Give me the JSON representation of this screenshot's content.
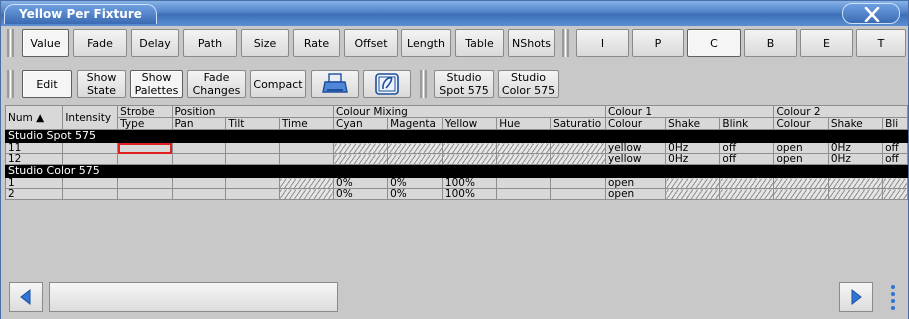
{
  "window": {
    "title": "Yellow Per Fixture"
  },
  "toolbar1": {
    "buttons": [
      "Value",
      "Fade",
      "Delay",
      "Path",
      "Size",
      "Rate",
      "Offset",
      "Length",
      "Table",
      "NShots"
    ],
    "feature_buttons": [
      "I",
      "P",
      "C",
      "B",
      "E",
      "T"
    ],
    "selected": "Value",
    "selected_feature": "C"
  },
  "toolbar2": {
    "edit": "Edit",
    "show_state": [
      "Show",
      "State"
    ],
    "show_palettes": [
      "Show",
      "Palettes"
    ],
    "fade_changes": [
      "Fade",
      "Changes"
    ],
    "compact": "Compact",
    "fixture_spot": [
      "Studio",
      "Spot 575"
    ],
    "fixture_color": [
      "Studio",
      "Color 575"
    ]
  },
  "grid": {
    "group_headers": {
      "strobe": "Strobe",
      "position": "Position",
      "colour_mixing": "Colour Mixing",
      "colour1": "Colour 1",
      "colour2": "Colour 2"
    },
    "columns": [
      "Num",
      "Intensity",
      "Type",
      "Pan",
      "Tilt",
      "Time",
      "Cyan",
      "Magenta",
      "Yellow",
      "Hue",
      "Saturatio",
      "Colour",
      "Shake",
      "Blink",
      "Colour",
      "Shake",
      "Bli"
    ],
    "sort_indicator": "▲",
    "groups": [
      {
        "name": "Studio Spot 575",
        "rows": [
          {
            "num": "11",
            "colour1": "yellow",
            "shake1": "0Hz",
            "blink1": "off",
            "colour2": "open",
            "shake2": "0Hz",
            "blink2": "off"
          },
          {
            "num": "12",
            "colour1": "yellow",
            "shake1": "0Hz",
            "blink1": "off",
            "colour2": "open",
            "shake2": "0Hz",
            "blink2": "off"
          }
        ]
      },
      {
        "name": "Studio Color 575",
        "rows": [
          {
            "num": "1",
            "cyan": "0%",
            "magenta": "0%",
            "yellow": "100%",
            "colour1": "open"
          },
          {
            "num": "2",
            "cyan": "0%",
            "magenta": "0%",
            "yellow": "100%",
            "colour1": "open"
          }
        ]
      }
    ]
  },
  "icons": {
    "close": "close-icon",
    "print": "print-icon",
    "palette": "palette-icon",
    "left": "arrow-left-icon",
    "right": "arrow-right-icon",
    "menu": "more-vertical-icon"
  }
}
